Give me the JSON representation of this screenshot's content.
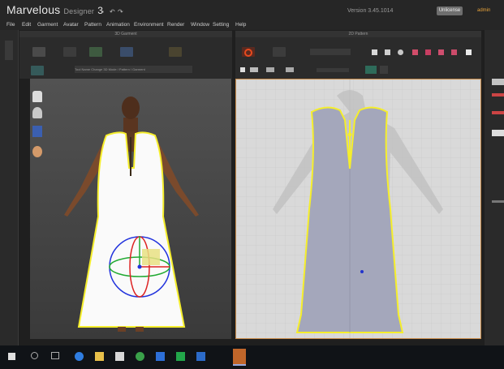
{
  "app": {
    "brand": "Marvelous",
    "brand_sub": "Designer",
    "brand_version": "3",
    "version_text": "Version 3.45.1014",
    "license_button": "Unlicense",
    "user_button": "admin"
  },
  "menu": [
    "File",
    "Edit",
    "Garment",
    "Avatar",
    "Pattern",
    "Animation",
    "Environment",
    "Render",
    "Window",
    "Setting",
    "Help"
  ],
  "panels": {
    "view3d_title": "3D Garment",
    "view2d_title": "2D Pattern"
  },
  "toolbar3d": {
    "field": "Tool Name Change 3D Mode / Pattern / Garment"
  },
  "colors": {
    "outline": "#f5ee2c",
    "garment3d": "#fafafa",
    "garment2d": "#a4a7bb",
    "accent": "#e8a33a"
  },
  "taskbar_icons": [
    "windows-start-icon",
    "search-icon",
    "task-view-icon",
    "edge-icon",
    "file-explorer-icon",
    "store-icon",
    "chrome-icon",
    "app-icon",
    "sheets-icon",
    "outlook-icon",
    "marvelous-icon"
  ]
}
